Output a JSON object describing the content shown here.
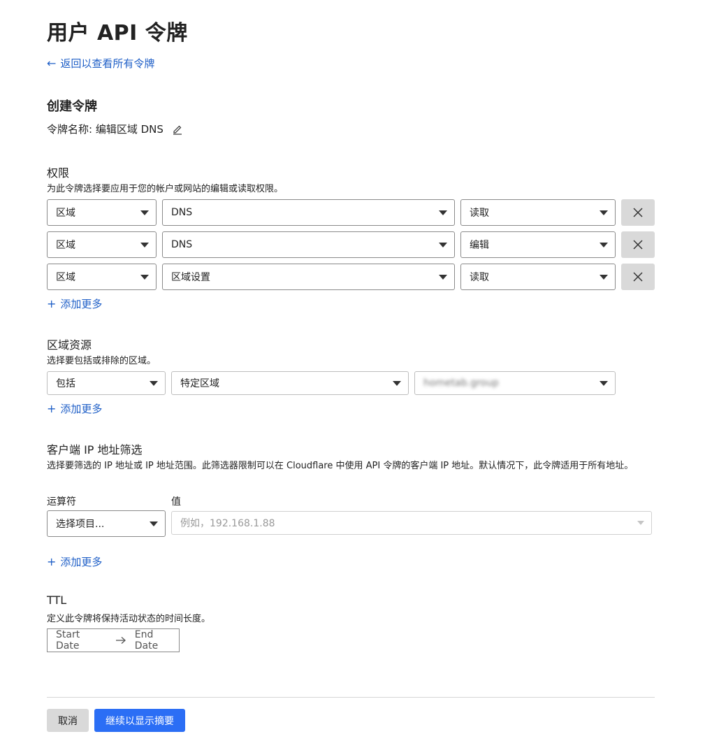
{
  "page": {
    "title": "用户 API 令牌",
    "back_link": "返回以查看所有令牌"
  },
  "create": {
    "heading": "创建令牌",
    "token_name_label": "令牌名称: 编辑区域 DNS"
  },
  "permissions": {
    "title": "权限",
    "description": "为此令牌选择要应用于您的帐户或网站的编辑或读取权限。",
    "rows": [
      {
        "scope": "区域",
        "resource": "DNS",
        "access": "读取"
      },
      {
        "scope": "区域",
        "resource": "DNS",
        "access": "编辑"
      },
      {
        "scope": "区域",
        "resource": "区域设置",
        "access": "读取"
      }
    ],
    "add_more": "添加更多"
  },
  "zone_resources": {
    "title": "区域资源",
    "description": "选择要包括或排除的区域。",
    "include": "包括",
    "type": "特定区域",
    "zone": "hometab.group",
    "add_more": "添加更多"
  },
  "ip_filter": {
    "title": "客户端 IP 地址筛选",
    "description": "选择要筛选的 IP 地址或 IP 地址范围。此筛选器限制可以在 Cloudflare 中使用 API 令牌的客户端 IP 地址。默认情况下，此令牌适用于所有地址。",
    "operator_label": "运算符",
    "value_label": "值",
    "operator_placeholder": "选择项目...",
    "value_placeholder": "例如，192.168.1.88",
    "add_more": "添加更多"
  },
  "ttl": {
    "title": "TTL",
    "description": "定义此令牌将保持活动状态的时间长度。",
    "start": "Start Date",
    "end": "End Date"
  },
  "actions": {
    "cancel": "取消",
    "continue": "继续以显示摘要"
  },
  "colors": {
    "link": "#1f5fc7",
    "primary": "#2b6ef5",
    "secondary": "#d9d9d9"
  }
}
